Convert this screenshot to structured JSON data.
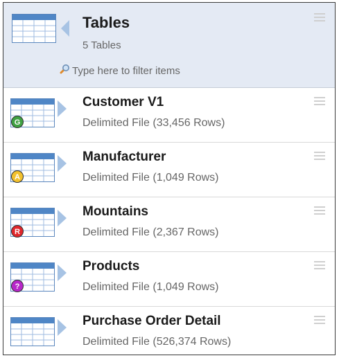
{
  "header": {
    "title": "Tables",
    "subtitle": "5 Tables",
    "filter_placeholder": "Type here to filter items"
  },
  "rows": [
    {
      "title": "Customer V1",
      "subtitle": "Delimited File  (33,456 Rows)",
      "badge": {
        "letter": "G",
        "color": "#3fa142"
      }
    },
    {
      "title": "Manufacturer",
      "subtitle": "Delimited File  (1,049 Rows)",
      "badge": {
        "letter": "A",
        "color": "#f2c12e"
      }
    },
    {
      "title": "Mountains",
      "subtitle": "Delimited File  (2,367 Rows)",
      "badge": {
        "letter": "R",
        "color": "#e0262b"
      }
    },
    {
      "title": "Products",
      "subtitle": "Delimited File  (1,049 Rows)",
      "badge": {
        "letter": "?",
        "color": "#b727c9"
      }
    },
    {
      "title": "Purchase Order Detail",
      "subtitle": "Delimited File  (526,374 Rows)",
      "badge": null
    }
  ],
  "icons": {
    "table": "table-icon",
    "back": "back-arrow-icon",
    "expand": "expand-arrow-icon",
    "menu": "menu-icon",
    "search": "search-icon"
  }
}
